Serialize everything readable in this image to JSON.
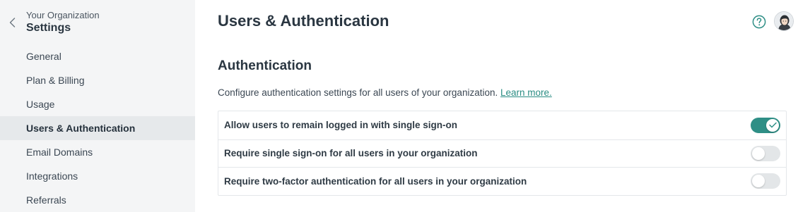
{
  "sidebar": {
    "org_name": "Your Organization",
    "title": "Settings",
    "items": [
      {
        "label": "General"
      },
      {
        "label": "Plan & Billing"
      },
      {
        "label": "Usage"
      },
      {
        "label": "Users & Authentication",
        "active": true
      },
      {
        "label": "Email Domains"
      },
      {
        "label": "Integrations"
      },
      {
        "label": "Referrals"
      }
    ]
  },
  "header": {
    "title": "Users & Authentication",
    "help_icon": "question-circle-icon",
    "avatar": "user-avatar"
  },
  "section": {
    "title": "Authentication",
    "description": "Configure authentication settings for all users of your organization.",
    "learn_more": "Learn more."
  },
  "settings": [
    {
      "label": "Allow users to remain logged in with single sign-on",
      "enabled": true
    },
    {
      "label": "Require single sign-on for all users in your organization",
      "enabled": false
    },
    {
      "label": "Require two-factor authentication for all users in your organization",
      "enabled": false
    }
  ],
  "colors": {
    "accent": "#2f8f86",
    "sidebar_bg": "#f4f5f6",
    "active_item_bg": "#e6e9eb",
    "toggle_off": "#e3e6e8"
  }
}
